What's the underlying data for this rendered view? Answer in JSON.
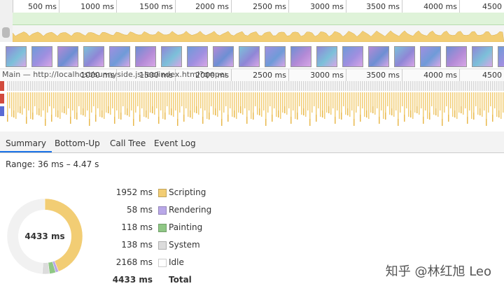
{
  "overview_ruler": {
    "ticks": [
      "500 ms",
      "1000 ms",
      "1500 ms",
      "2000 ms",
      "2500 ms",
      "3000 ms",
      "3500 ms",
      "4000 ms",
      "4500"
    ]
  },
  "main_track": {
    "title": "Main — http://localhost/sunnyside.js-leo/index.html?q=perf",
    "ticks": [
      "1000 ms",
      "1500 ms",
      "2000 ms",
      "2500 ms",
      "3000 ms",
      "3500 ms",
      "4000 ms",
      "4500"
    ]
  },
  "tabs": [
    {
      "label": "Summary",
      "active": true
    },
    {
      "label": "Bottom-Up",
      "active": false
    },
    {
      "label": "Call Tree",
      "active": false
    },
    {
      "label": "Event Log",
      "active": false
    }
  ],
  "summary": {
    "range": "Range: 36 ms – 4.47 s",
    "total_center": "4433 ms",
    "rows": [
      {
        "value": "1952 ms",
        "category": "Scripting",
        "color": "#f2cd74"
      },
      {
        "value": "58 ms",
        "category": "Rendering",
        "color": "#b9a8e8"
      },
      {
        "value": "118 ms",
        "category": "Painting",
        "color": "#8fc785"
      },
      {
        "value": "138 ms",
        "category": "System",
        "color": "#dcdcdc"
      },
      {
        "value": "2168 ms",
        "category": "Idle",
        "color": "#ffffff"
      }
    ],
    "total": {
      "value": "4433 ms",
      "label": "Total"
    }
  },
  "watermark": "知乎 @林红旭 Leo",
  "colors": {
    "accent": "#1a73e8",
    "fps": "#dff3d9",
    "cpu_scripting": "#f2cd74"
  }
}
